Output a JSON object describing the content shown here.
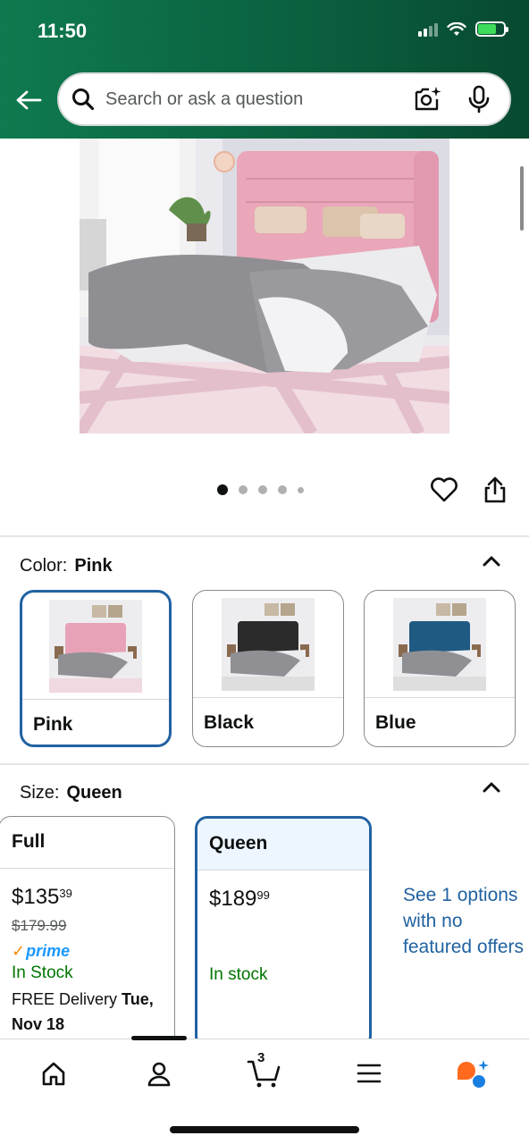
{
  "status_bar": {
    "time": "11:50"
  },
  "search": {
    "placeholder": "Search or ask a question"
  },
  "gallery": {
    "image_count": 5,
    "active_index": 0
  },
  "color": {
    "label": "Color:",
    "selected": "Pink",
    "options": [
      {
        "name": "Pink",
        "selected": true,
        "headboard_color": "#e8a2b8"
      },
      {
        "name": "Black",
        "selected": false,
        "headboard_color": "#2b2b2b"
      },
      {
        "name": "Blue",
        "selected": false,
        "headboard_color": "#1f5a82"
      }
    ]
  },
  "size": {
    "label": "Size:",
    "selected": "Queen",
    "options": [
      {
        "name": "Full",
        "price_whole": "$135",
        "price_fraction": "39",
        "list_price": "$179.99",
        "prime": "prime",
        "stock": "In Stock",
        "delivery_prefix": "FREE Delivery",
        "delivery_date": "Tue, Nov 18"
      },
      {
        "name": "Queen",
        "price_whole": "$189",
        "price_fraction": "99",
        "stock": "In stock"
      }
    ],
    "see_options": "See 1 options with no featured offers"
  },
  "bottom_nav": {
    "cart_count": "3"
  },
  "colors": {
    "header_green": "#0c6a45",
    "selected_border": "#2162a1",
    "link_blue": "#2162a1",
    "stock_green": "#007600",
    "prime_blue": "#1a98ff"
  }
}
